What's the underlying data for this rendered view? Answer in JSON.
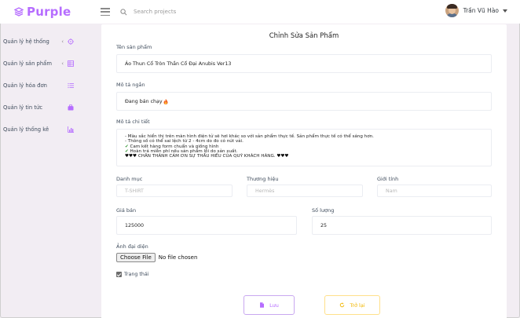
{
  "brand": {
    "name": "Purple",
    "color": "#b66dff"
  },
  "header": {
    "search_placeholder": "Search projects",
    "user_name": "Trần Vũ Hào"
  },
  "sidebar": {
    "items": [
      {
        "label": "Quản lý hệ thống",
        "has_chevron": true,
        "icon": "crosshair-icon"
      },
      {
        "label": "Quản lý sản phẩm",
        "has_chevron": true,
        "icon": "table-icon"
      },
      {
        "label": "Quản lý hóa đơn",
        "has_chevron": false,
        "icon": "list-icon"
      },
      {
        "label": "Quản lý tin tức",
        "has_chevron": false,
        "icon": "briefcase-icon"
      },
      {
        "label": "Quản lý thống kê",
        "has_chevron": false,
        "icon": "bar-chart-icon"
      }
    ]
  },
  "form": {
    "title": "Chỉnh Sửa Sản Phẩm",
    "name": {
      "label": "Tên sản phẩm",
      "value": "Áo Thun Cổ Tròn Thần Cổ Đại Anubis Ver13"
    },
    "short_desc": {
      "label": "Mô tả ngắn",
      "value": "Đang bán chạy"
    },
    "detail_desc": {
      "label": "Mô tả chi tiết",
      "line1": "- Màu sắc hiển thị trên màn hình điện tử sẽ hơi khác so với sản phẩm thực tế. Sản phẩm thực tế có thể sáng hơn.",
      "line2": "- Thông số có thể sai lệch từ 2 - 4cm do đo có nút vải.",
      "line3": "Cam kết hàng form chuẩn và giống hình",
      "line4": "Hoàn trả miễn phí nếu sản phẩm lỗi do sản xuất.",
      "line5_hearts": "♥♥♥",
      "line5_text": "CHÂN THÀNH CẢM ƠN SỰ THẤU HIỂU CỦA QUÝ KHÁCH HÀNG.",
      "check_mark": "✔"
    },
    "category": {
      "label": "Danh mục",
      "placeholder": "T-SHIRT"
    },
    "brand": {
      "label": "Thương hiệu",
      "placeholder": "Hermès"
    },
    "gender": {
      "label": "Giới tính",
      "placeholder": "Nam"
    },
    "price": {
      "label": "Giá bán",
      "value": "125000"
    },
    "quantity": {
      "label": "Số lượng",
      "value": "25"
    },
    "image": {
      "label": "Ảnh đại diện",
      "button": "Choose File",
      "status": "No file chosen"
    },
    "status": {
      "label": "Trạng thái",
      "checked": true
    },
    "save_button": "Lưu",
    "back_button": "Trở lại"
  },
  "colors": {
    "background": "#f2edf3",
    "save": "#b66dff",
    "back": "#f2b600"
  }
}
